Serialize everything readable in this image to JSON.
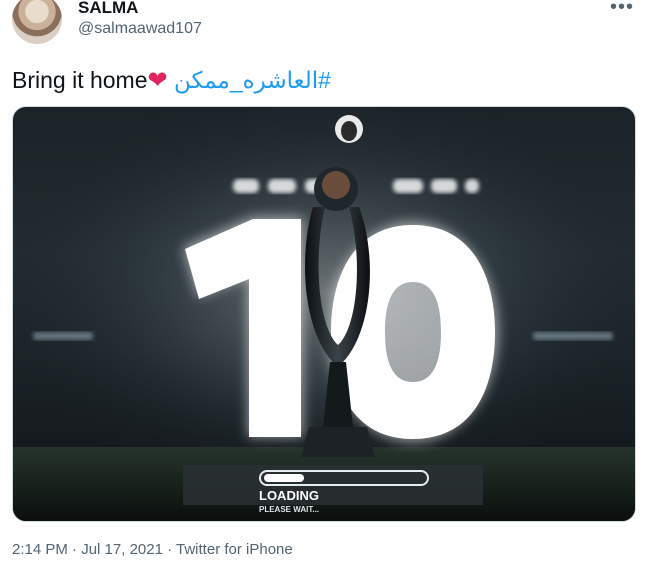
{
  "user": {
    "display_name": "SALMA",
    "handle": "@salmaawad107"
  },
  "tweet": {
    "text": "Bring it home",
    "emoji": "❤",
    "hashtag": "#العاشره_ممكن"
  },
  "media": {
    "big_number": "10",
    "loading_label": "LOADING",
    "loading_sub": "PLEASE WAIT...",
    "loading_progress": 0.25
  },
  "footer": {
    "time": "2:14 PM",
    "separator": " · ",
    "date": "Jul 17, 2021",
    "source": "Twitter for iPhone"
  },
  "icons": {
    "more": "more-options-icon"
  },
  "colors": {
    "hashtag": "#1d9bf0",
    "heart": "#e0245e",
    "secondary_text": "#536471"
  }
}
